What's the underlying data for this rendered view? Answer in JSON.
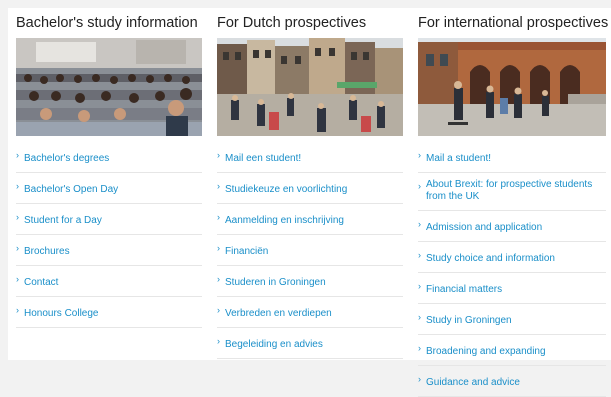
{
  "columns": [
    {
      "title": "Bachelor's study information",
      "links": [
        "Bachelor's degrees",
        "Bachelor's Open Day",
        "Student for a Day",
        "Brochures",
        "Contact",
        "Honours College"
      ]
    },
    {
      "title": "For Dutch prospectives",
      "links": [
        "Mail een student!",
        "Studiekeuze en voorlichting",
        "Aanmelding en inschrijving",
        "Financiën",
        "Studeren in Groningen",
        "Verbreden en verdiepen",
        "Begeleiding en advies"
      ]
    },
    {
      "title": "For international prospectives",
      "links": [
        "Mail a student!",
        "About Brexit: for prospective students from the UK",
        "Admission and application",
        "Study choice and information",
        "Financial matters",
        "Study in Groningen",
        "Broadening and expanding",
        "Guidance and advice"
      ]
    }
  ],
  "bullet_glyph": "›",
  "colors": {
    "link": "#1a8fc9",
    "heading": "#222222",
    "divider": "#e6e6e6",
    "page_background": "#f2f2f2"
  },
  "icons": {
    "bullet": "chevron-right-icon"
  }
}
